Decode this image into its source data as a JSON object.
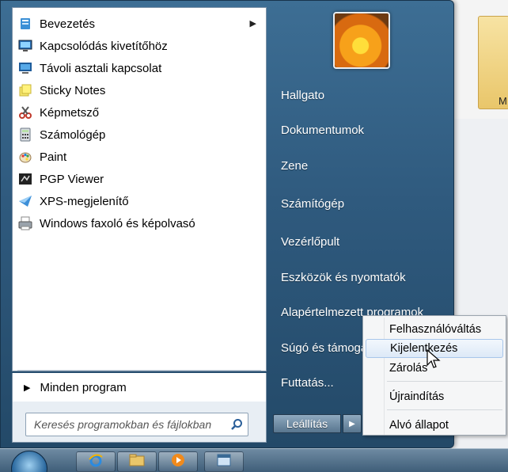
{
  "start_menu": {
    "programs": [
      {
        "label": "Bevezetés",
        "icon": "getting-started-icon",
        "has_submenu": true
      },
      {
        "label": "Kapcsolódás kivetítőhöz",
        "icon": "projector-icon",
        "has_submenu": false
      },
      {
        "label": "Távoli asztali kapcsolat",
        "icon": "remote-desktop-icon",
        "has_submenu": false
      },
      {
        "label": "Sticky Notes",
        "icon": "sticky-notes-icon",
        "has_submenu": false
      },
      {
        "label": "Képmetsző",
        "icon": "snipping-tool-icon",
        "has_submenu": false
      },
      {
        "label": "Számológép",
        "icon": "calculator-icon",
        "has_submenu": false
      },
      {
        "label": "Paint",
        "icon": "paint-icon",
        "has_submenu": false
      },
      {
        "label": "PGP Viewer",
        "icon": "pgp-viewer-icon",
        "has_submenu": false
      },
      {
        "label": "XPS-megjelenítő",
        "icon": "xps-viewer-icon",
        "has_submenu": false
      },
      {
        "label": "Windows faxoló és képolvasó",
        "icon": "fax-scan-icon",
        "has_submenu": false
      }
    ],
    "all_programs_label": "Minden program",
    "search_placeholder": "Keresés programokban és fájlokban",
    "right_items": [
      "Hallgato",
      "Dokumentumok",
      "Zene",
      "Számítógép",
      "Vezérlőpult",
      "Eszközök és nyomtatók",
      "Alapértelmezett programok",
      "Súgó és támogatás",
      "Futtatás..."
    ],
    "shutdown_label": "Leállítás"
  },
  "shutdown_menu": {
    "items": [
      "Felhasználóváltás",
      "Kijelentkezés",
      "Zárolás",
      "Újraindítás",
      "Alvó állapot"
    ],
    "highlighted": "Kijelentkezés"
  },
  "desktop": {
    "folder_label": "M"
  },
  "colors": {
    "menu_blue": "#2f5a7e",
    "highlight": "#dde9f7"
  }
}
